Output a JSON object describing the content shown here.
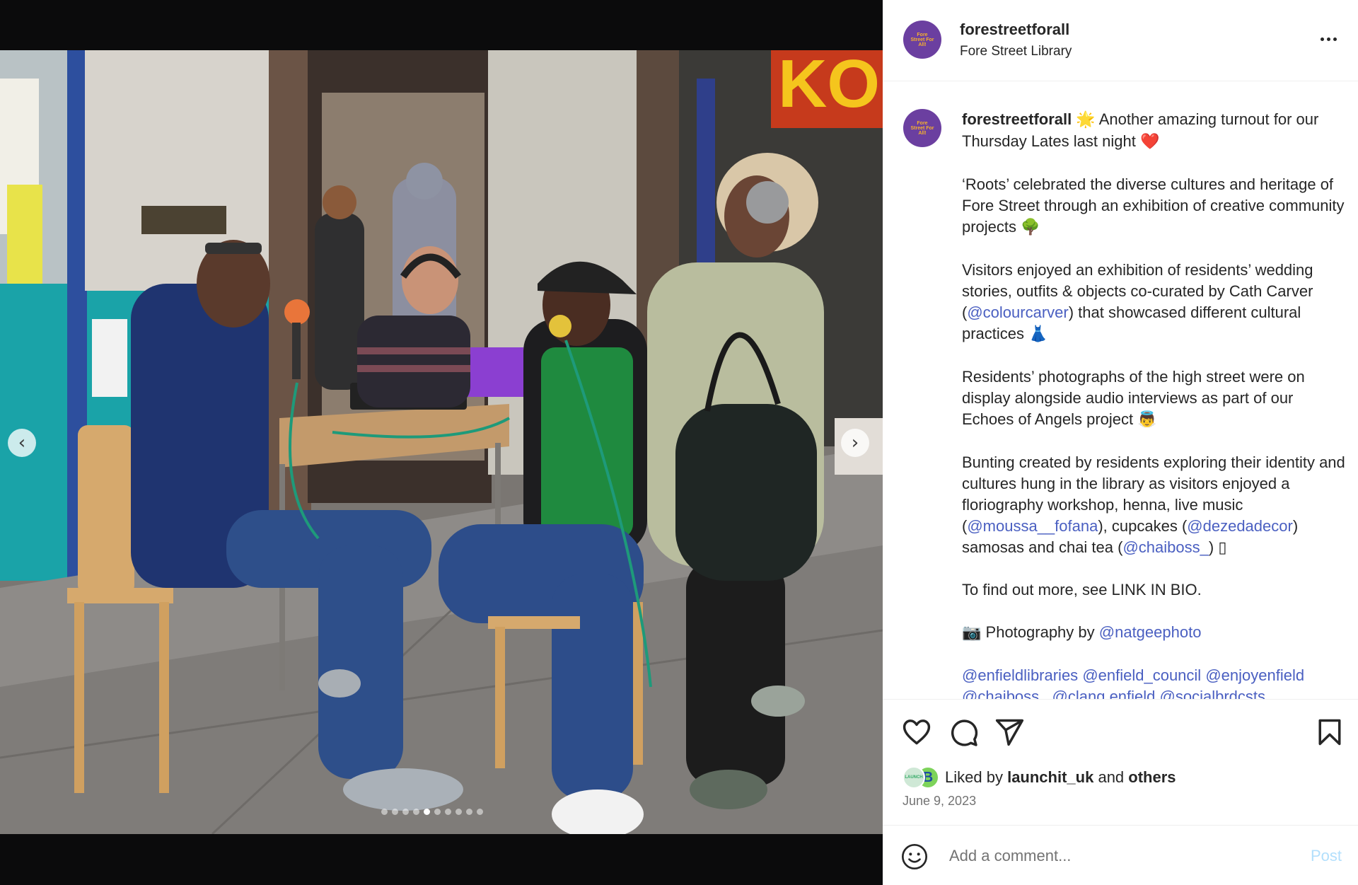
{
  "carousel": {
    "prev_arrow": "‹",
    "next_arrow": "›",
    "dot_count": 10,
    "active_index": 4
  },
  "post": {
    "avatar_text": "Fore Street For All!",
    "username": "forestreetforall",
    "location": "Fore Street Library",
    "more_icon": "more-horizontal-icon"
  },
  "caption": {
    "username": "forestreetforall",
    "p1_a": "Another amazing turnout for our Thursday Lates last night",
    "e_star": "🌟",
    "e_heart": "❤️",
    "p2": "‘Roots’ celebrated the diverse cultures and heritage of Fore Street through an exhibition of creative community projects",
    "e_tree": "🌳",
    "p3_a": "Visitors enjoyed an exhibition of residents’ wedding stories, outfits & objects co-curated by Cath Carver (",
    "p3_mention": "@colourcarver",
    "p3_b": ") that showcased different cultural practices",
    "e_dress": "👗",
    "p4": "Residents’ photographs of the high street were on display alongside audio interviews as part of our Echoes of Angels project",
    "e_angel": "👼",
    "p5_a": "Bunting created by residents exploring their identity and cultures hung in the library as visitors enjoyed a floriography workshop, henna, live music (",
    "p5_m1": "@moussa__fofana",
    "p5_b": "), cupcakes (",
    "p5_m2": "@dezedadecor",
    "p5_c": ") samosas and chai tea (",
    "p5_m3": "@chaiboss_",
    "p5_d": ") ▯",
    "p6": "To find out more, see LINK IN BIO.",
    "e_camera": "📷",
    "p7_a": "Photography by",
    "p7_mention": "@natgeephoto",
    "tags_line1": [
      "@enfieldlibraries",
      "@enfield_council",
      "@enjoyenfield"
    ],
    "tags_line2": [
      "@chaiboss_",
      "@clang.enfield",
      "@socialbrdcsts"
    ]
  },
  "actions": {
    "icons": [
      "heart-icon",
      "comment-icon",
      "share-icon",
      "bookmark-icon"
    ],
    "liked_by_prefix": "Liked by",
    "liked_by_user": "launchit_uk",
    "liked_by_and": "and",
    "liked_by_others": "others",
    "liker_avatar_1": "LAUNCH",
    "liker_avatar_2": "B",
    "date": "June 9, 2023"
  },
  "comment": {
    "placeholder": "Add a comment...",
    "post_label": "Post",
    "emoji_icon": "smiley-icon"
  },
  "colors": {
    "avatar_bg": "#6b3fa0",
    "mention": "#4a5fc1",
    "post_button": "#b2dffc",
    "muted": "#737373"
  }
}
